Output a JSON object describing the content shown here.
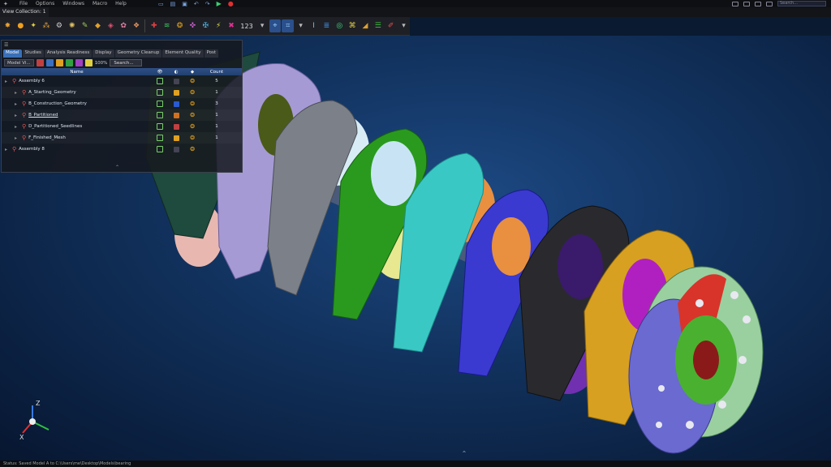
{
  "menubar": {
    "items": [
      "File",
      "Options",
      "Windows",
      "Macro",
      "Help"
    ],
    "search_placeholder": "Search..."
  },
  "view_collection": "View Collection: 1",
  "toolbar": {
    "number_label": "123"
  },
  "panel": {
    "tabs": [
      "Model",
      "Studies",
      "Analysis Readiness",
      "Display",
      "Geometry Cleanup",
      "Element Quality",
      "Post"
    ],
    "model_view_dropdown": "Model Vi...",
    "zoom": "100%",
    "search_label": "Search...",
    "columns": {
      "name": "Name",
      "count": "Count"
    },
    "rows": [
      {
        "name": "Assembly 6",
        "level": 0,
        "count": "5",
        "color": "",
        "underline": false
      },
      {
        "name": "A_Starting_Geometry",
        "level": 1,
        "count": "1",
        "color": "#e0a020",
        "underline": false
      },
      {
        "name": "B_Construction_Geometry",
        "level": 1,
        "count": "3",
        "color": "#2a5ad0",
        "underline": false
      },
      {
        "name": "B_Partitioned",
        "level": 1,
        "count": "1",
        "color": "#d07020",
        "underline": true
      },
      {
        "name": "D_Partitioned_Seedlines",
        "level": 1,
        "count": "1",
        "color": "#c04040",
        "underline": false
      },
      {
        "name": "F_Finished_Mesh",
        "level": 1,
        "count": "1",
        "color": "#e0a020",
        "underline": false
      },
      {
        "name": "Assembly 8",
        "level": 0,
        "count": "",
        "color": "",
        "underline": false
      }
    ]
  },
  "triad": {
    "z": "Z",
    "x": "X"
  },
  "status": "Status: Saved Model  A to C:\\Users\\me\\Desktop\\Models\\bearing"
}
